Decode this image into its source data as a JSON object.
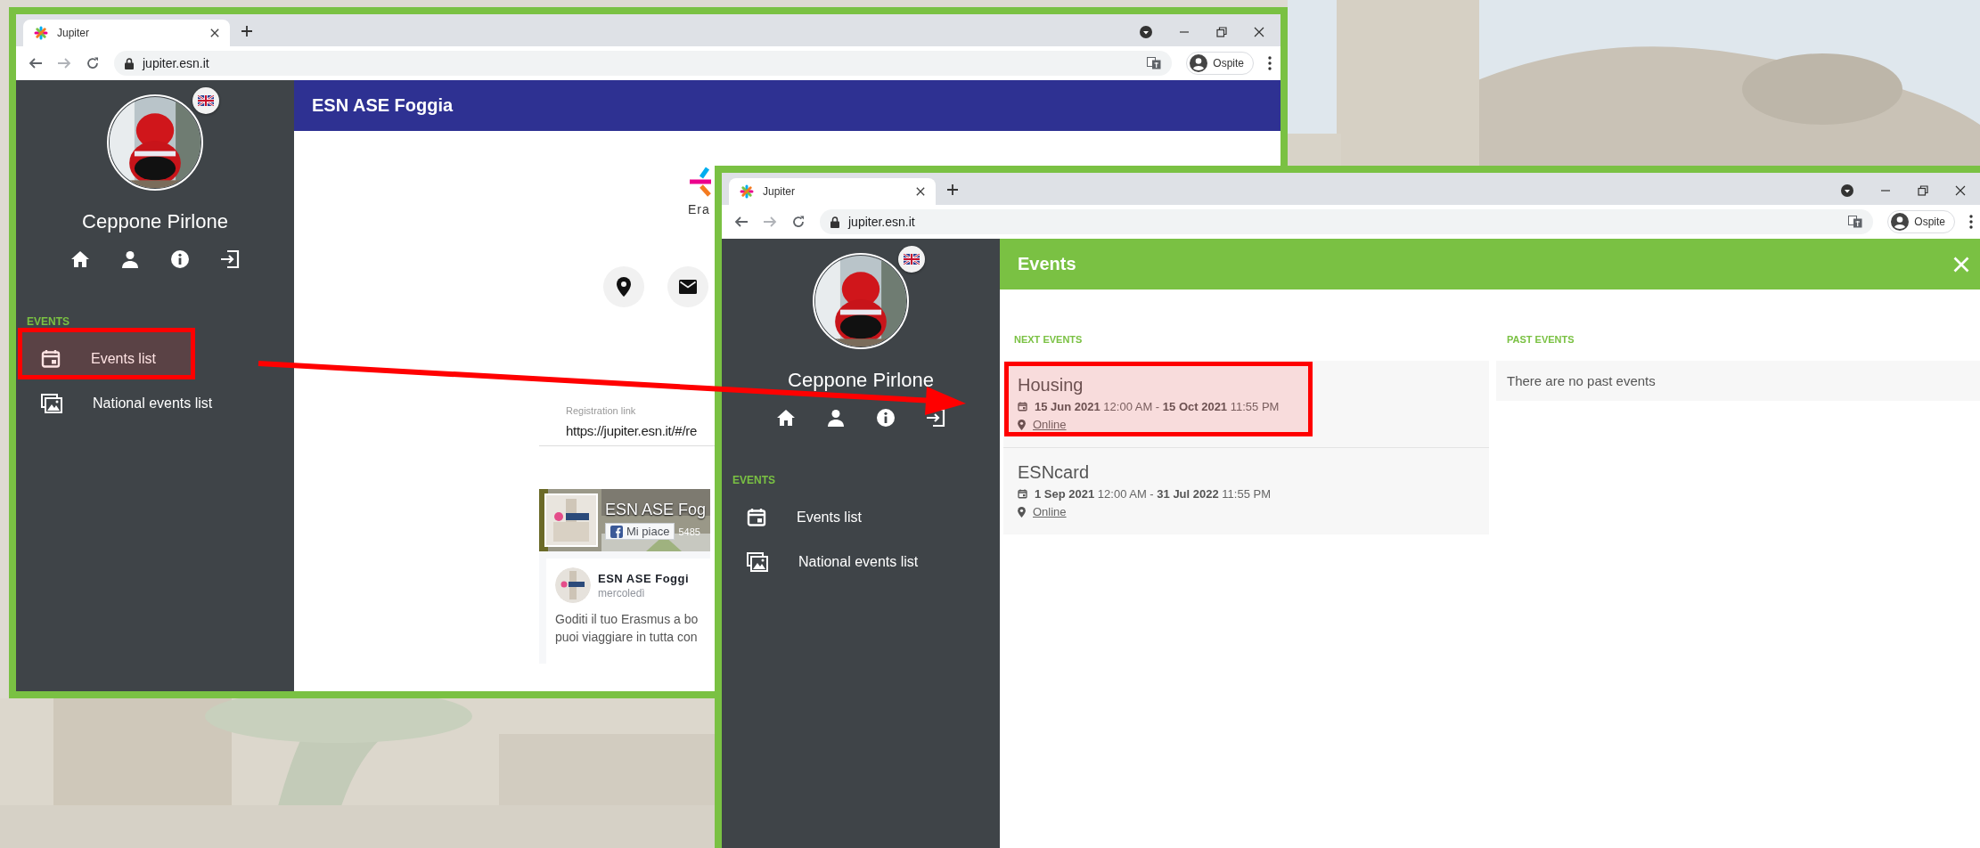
{
  "windows": [
    {
      "tab": {
        "title": "Jupiter"
      },
      "address": "jupiter.esn.it",
      "profile": "Ospite",
      "sidebar": {
        "user_name": "Ceppone Pirlone",
        "section": "EVENTS",
        "items": [
          {
            "label": "Events list",
            "kind": "calendar"
          },
          {
            "label": "National events list",
            "kind": "images"
          }
        ]
      },
      "header": {
        "title": "ESN ASE Foggia",
        "kind": "organization",
        "closable": false
      },
      "page": {
        "kind": "section",
        "logo_caption": "Era",
        "registration": {
          "label": "Registration link",
          "value": "https://jupiter.esn.it/#/re"
        },
        "facebook": {
          "page_name": "ESN ASE Fog",
          "like_button": "Mi piace",
          "like_count": "5485",
          "post_author": "ESN ASE Foggi",
          "post_date": "mercoledì",
          "post_text": [
            "Goditi il tuo Erasmus a bo",
            "puoi viaggiare in tutta con"
          ]
        }
      }
    },
    {
      "tab": {
        "title": "Jupiter"
      },
      "address": "jupiter.esn.it",
      "profile": "Ospite",
      "sidebar": {
        "user_name": "Ceppone Pirlone",
        "section": "EVENTS",
        "items": [
          {
            "label": "Events list",
            "kind": "calendar"
          },
          {
            "label": "National events list",
            "kind": "images"
          }
        ]
      },
      "header": {
        "title": "Events",
        "kind": "events",
        "closable": true
      },
      "page": {
        "kind": "events",
        "next": {
          "label": "NEXT EVENTS",
          "events": [
            {
              "title": "Housing",
              "dates": "**15 Jun 2021** 12:00 AM - **15 Oct 2021** 11:55 PM",
              "location": "Online"
            },
            {
              "title": "ESNcard",
              "dates": "**1 Sep 2021** 12:00 AM - **31 Jul 2022** 11:55 PM",
              "location": "Online"
            }
          ]
        },
        "past": {
          "label": "PAST EVENTS",
          "empty_text": "There are no past events"
        }
      }
    }
  ]
}
